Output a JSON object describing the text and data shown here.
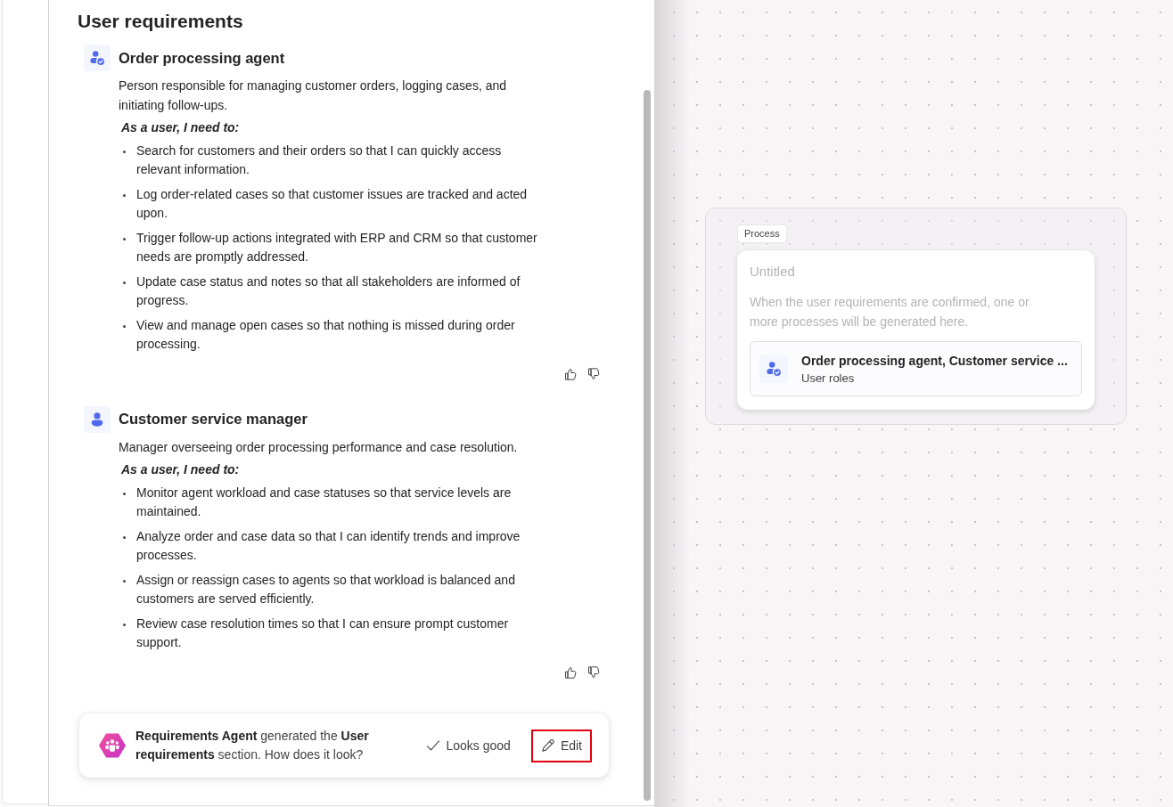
{
  "panel": {
    "title": "User requirements",
    "roles": [
      {
        "name": "Order processing agent",
        "verified": true,
        "description": "Person responsible for managing customer orders, logging cases, and initiating follow-ups.",
        "needs_label": "As a user, I need to:",
        "needs": [
          "Search for customers and their orders so that I can quickly access relevant information.",
          "Log order-related cases so that customer issues are tracked and acted upon.",
          "Trigger follow-up actions integrated with ERP and CRM so that customer needs are promptly addressed.",
          "Update case status and notes so that all stakeholders are informed of progress.",
          "View and manage open cases so that nothing is missed during order processing."
        ]
      },
      {
        "name": "Customer service manager",
        "verified": false,
        "description": "Manager overseeing order processing performance and case resolution.",
        "needs_label": "As a user, I need to:",
        "needs": [
          "Monitor agent workload and case statuses so that service levels are maintained.",
          "Analyze order and case data so that I can identify trends and improve processes.",
          "Assign or reassign cases to agents so that workload is balanced and customers are served efficiently.",
          "Review case resolution times so that I can ensure prompt customer support."
        ]
      }
    ],
    "feedback": {
      "message": "**Requirements Agent** generated the **User requirements** section. How does it look?",
      "actions": [
        {
          "kind": "approve",
          "label": "Looks good",
          "highlighted": false
        },
        {
          "kind": "edit",
          "label": "Edit",
          "highlighted": true
        }
      ]
    }
  },
  "canvas": {
    "group": {
      "tag": "Process",
      "card": {
        "title": "Untitled",
        "description": "When the user requirements are confirmed, one or more processes will be generated here.",
        "item": {
          "title": "Order processing agent, Customer service ...",
          "subtitle": "User roles",
          "verified": true
        }
      }
    }
  }
}
